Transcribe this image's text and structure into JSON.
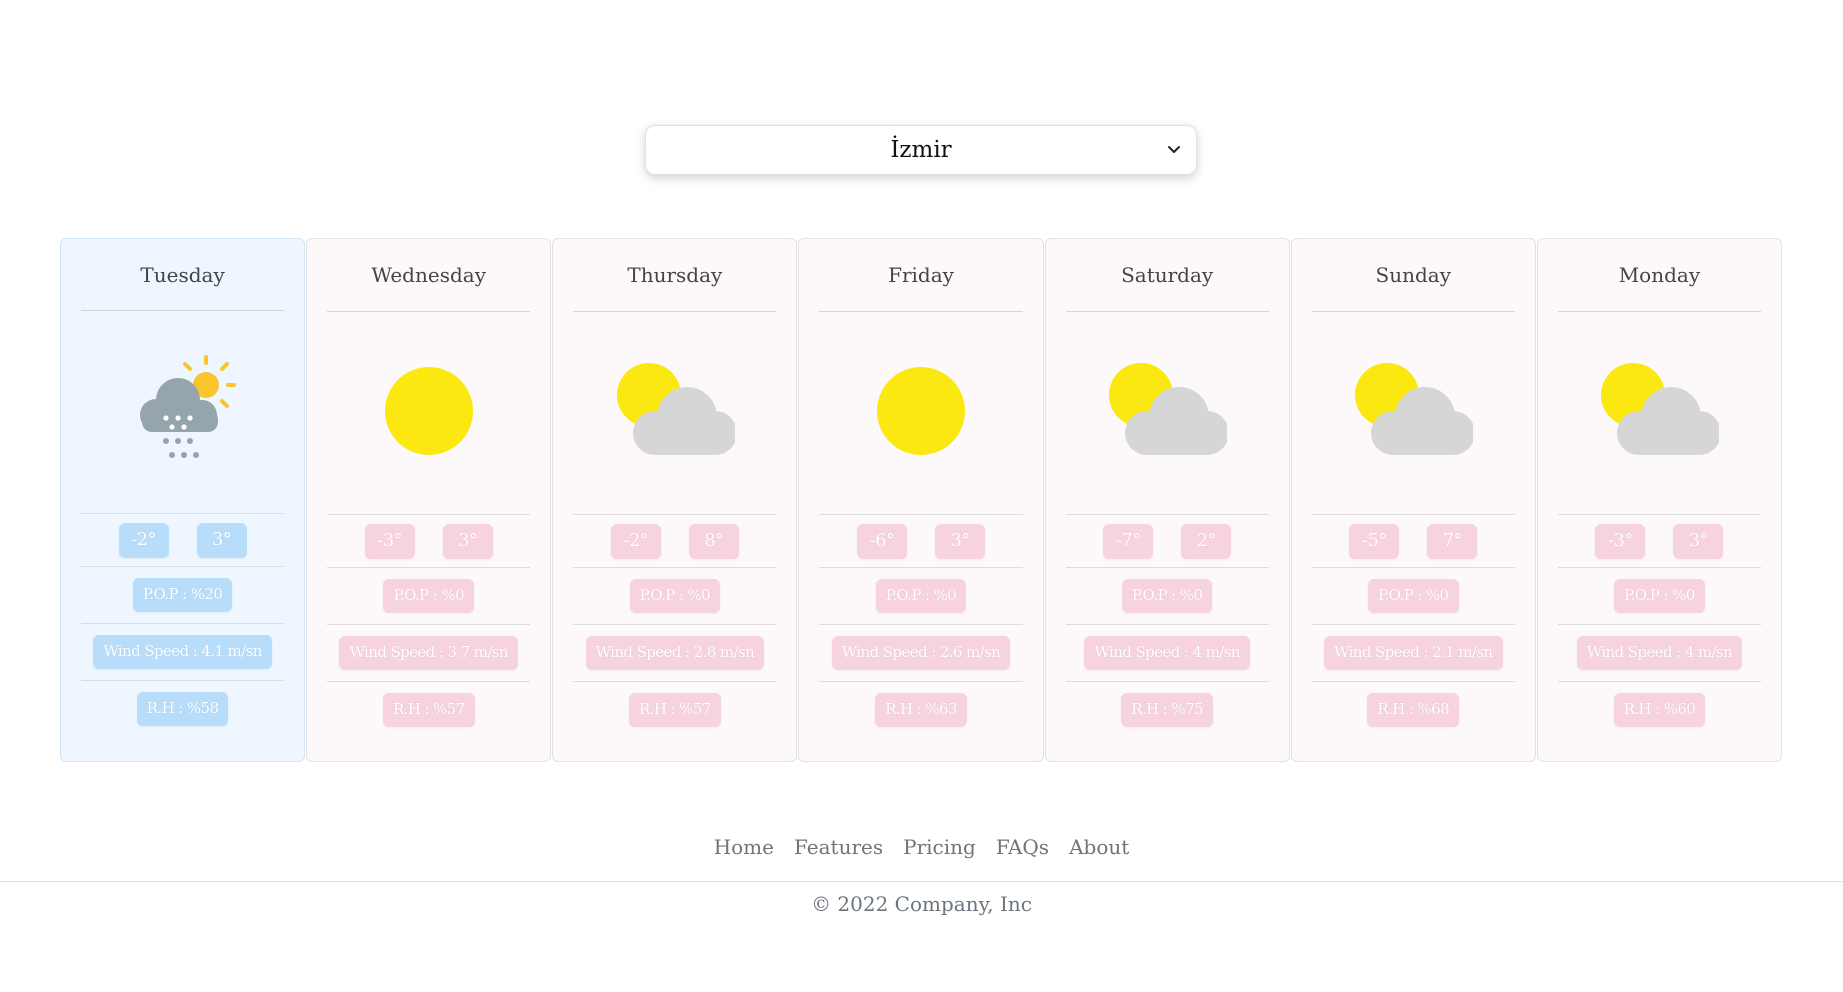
{
  "location_select": {
    "selected": "İzmir"
  },
  "colors": {
    "active_card_bg": "#eef6ff",
    "card_bg": "#fdf9fa",
    "pill_pink": "#f6d3dd",
    "pill_blue": "#b7ddfb",
    "sun_yellow": "#fbe810",
    "cloud_gray": "#d6d6d6"
  },
  "forecast": [
    {
      "day": "Tuesday",
      "icon": "snow-sun-icon",
      "active": true,
      "temp_min": "-2°",
      "temp_max": "3°",
      "pop": "P.O.P : %20",
      "wind": "Wind Speed : 4.1 m/sn",
      "rh": "R.H : %58"
    },
    {
      "day": "Wednesday",
      "icon": "sun-icon",
      "active": false,
      "temp_min": "-3°",
      "temp_max": "3°",
      "pop": "P.O.P : %0",
      "wind": "Wind Speed : 3.7 m/sn",
      "rh": "R.H : %57"
    },
    {
      "day": "Thursday",
      "icon": "partly-cloudy-icon",
      "active": false,
      "temp_min": "-2°",
      "temp_max": "8°",
      "pop": "P.O.P : %0",
      "wind": "Wind Speed : 2.8 m/sn",
      "rh": "R.H : %57"
    },
    {
      "day": "Friday",
      "icon": "sun-icon",
      "active": false,
      "temp_min": "-6°",
      "temp_max": "3°",
      "pop": "P.O.P : %0",
      "wind": "Wind Speed : 2.6 m/sn",
      "rh": "R.H : %63"
    },
    {
      "day": "Saturday",
      "icon": "partly-cloudy-icon",
      "active": false,
      "temp_min": "-7°",
      "temp_max": "2°",
      "pop": "P.O.P : %0",
      "wind": "Wind Speed : 4 m/sn",
      "rh": "R.H : %75"
    },
    {
      "day": "Sunday",
      "icon": "partly-cloudy-icon",
      "active": false,
      "temp_min": "-5°",
      "temp_max": "7°",
      "pop": "P.O.P : %0",
      "wind": "Wind Speed : 2.1 m/sn",
      "rh": "R.H : %68"
    },
    {
      "day": "Monday",
      "icon": "partly-cloudy-icon",
      "active": false,
      "temp_min": "-3°",
      "temp_max": "3°",
      "pop": "P.O.P : %0",
      "wind": "Wind Speed : 4 m/sn",
      "rh": "R.H : %60"
    }
  ],
  "footer": {
    "links": [
      "Home",
      "Features",
      "Pricing",
      "FAQs",
      "About"
    ],
    "copyright": "© 2022 Company, Inc"
  }
}
